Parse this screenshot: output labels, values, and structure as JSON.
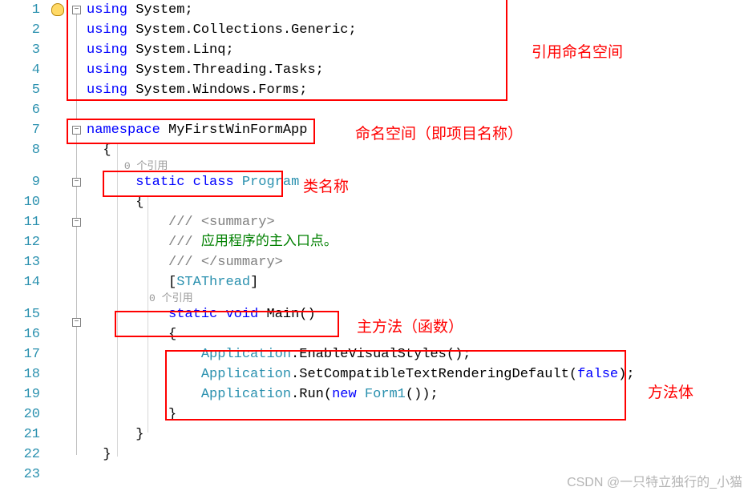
{
  "lines": {
    "count": 23,
    "l1": {
      "kw": "using",
      "ns": "System",
      "semi": ";"
    },
    "l2": {
      "kw": "using",
      "ns": "System.Collections.Generic",
      "semi": ";"
    },
    "l3": {
      "kw": "using",
      "ns": "System.Linq",
      "semi": ";"
    },
    "l4": {
      "kw": "using",
      "ns": "System.Threading.Tasks",
      "semi": ";"
    },
    "l5": {
      "kw": "using",
      "ns": "System.Windows.Forms",
      "semi": ";"
    },
    "l7": {
      "kw": "namespace",
      "name": "MyFirstWinFormApp"
    },
    "l8": {
      "brace": "{"
    },
    "ref1": "0 个引用",
    "l9": {
      "kw1": "static",
      "kw2": "class",
      "name": "Program"
    },
    "l10": {
      "brace": "{"
    },
    "l11": {
      "slashes": "/// ",
      "tag": "<summary>"
    },
    "l12": {
      "slashes": "/// ",
      "text": "应用程序的主入口点。"
    },
    "l13": {
      "slashes": "/// ",
      "tag": "</summary>"
    },
    "l14": {
      "lbr": "[",
      "attr": "STAThread",
      "rbr": "]"
    },
    "ref2": "0 个引用",
    "l15": {
      "kw1": "static",
      "kw2": "void",
      "name": "Main",
      "parens": "()"
    },
    "l16": {
      "brace": "{"
    },
    "l17": {
      "app": "Application",
      "dot": ".",
      "method": "EnableVisualStyles",
      "rest": "();"
    },
    "l18": {
      "app": "Application",
      "dot": ".",
      "method": "SetCompatibleTextRenderingDefault",
      "paren": "(",
      "kw": "false",
      "rest": ");"
    },
    "l19": {
      "app": "Application",
      "dot": ".",
      "method": "Run",
      "paren": "(",
      "kw": "new",
      "type": "Form1",
      "rest": "());"
    },
    "l20": {
      "brace": "}"
    },
    "l21": {
      "brace": "}"
    },
    "l22": {
      "brace": "}"
    }
  },
  "annotations": {
    "usings": "引用命名空间",
    "namespace": "命名空间（即项目名称）",
    "classname": "类名称",
    "mainmethod": "主方法（函数）",
    "methodbody": "方法体"
  },
  "watermark": "CSDN @一只特立独行的_小猫",
  "fold_positions": [
    0,
    6,
    8,
    10,
    14
  ],
  "line_numbers": [
    "1",
    "2",
    "3",
    "4",
    "5",
    "6",
    "7",
    "8",
    "9",
    "10",
    "11",
    "12",
    "13",
    "14",
    "15",
    "16",
    "17",
    "18",
    "19",
    "20",
    "21",
    "22",
    "23"
  ]
}
